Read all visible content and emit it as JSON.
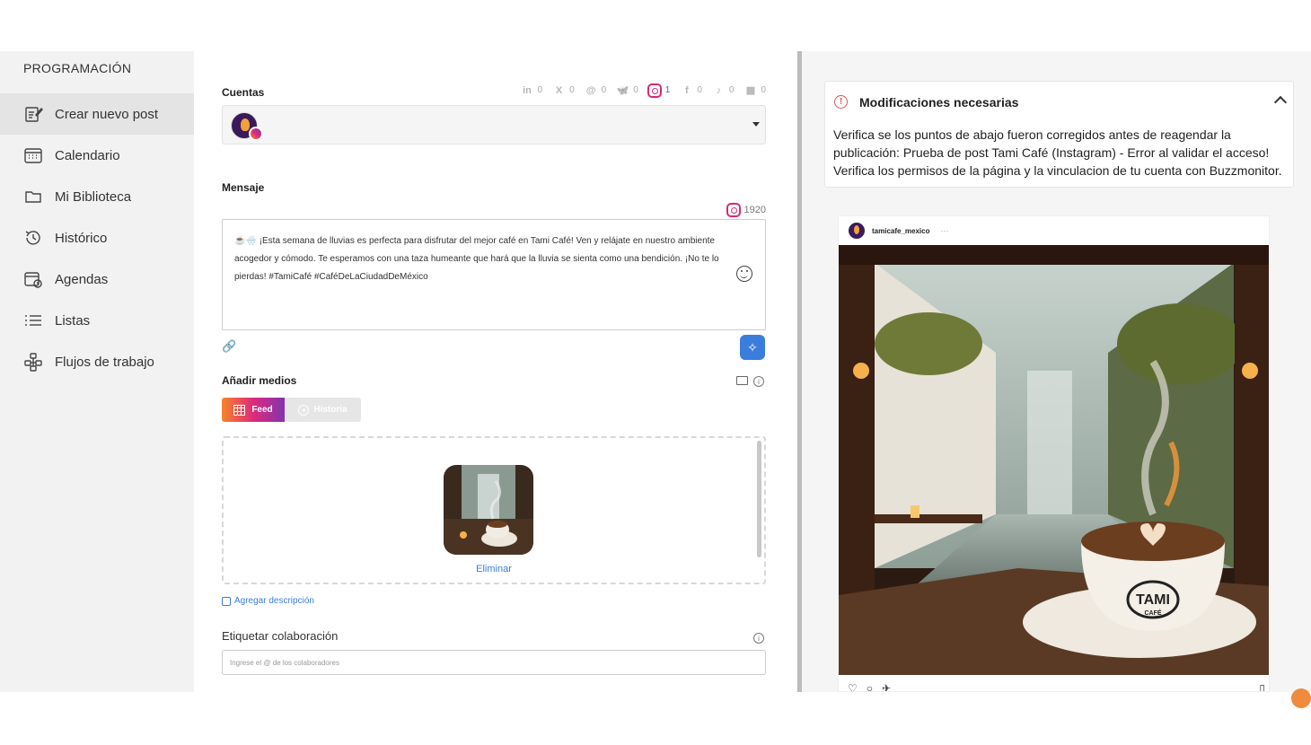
{
  "sidebar": {
    "heading": "PROGRAMACIÓN",
    "items": [
      {
        "label": "Crear nuevo post",
        "icon": "edit-post-icon",
        "active": true
      },
      {
        "label": "Calendario",
        "icon": "calendar-icon"
      },
      {
        "label": "Mi Biblioteca",
        "icon": "folder-icon"
      },
      {
        "label": "Histórico",
        "icon": "history-icon"
      },
      {
        "label": "Agendas",
        "icon": "schedule-icon"
      },
      {
        "label": "Listas",
        "icon": "list-icon"
      },
      {
        "label": "Flujos de trabajo",
        "icon": "workflow-icon"
      }
    ]
  },
  "composer": {
    "accounts_label": "Cuentas",
    "networks": [
      {
        "name": "linkedin-icon",
        "glyph": "in",
        "count": "0"
      },
      {
        "name": "x-icon",
        "glyph": "X",
        "count": "0"
      },
      {
        "name": "threads-icon",
        "glyph": "@",
        "count": "0"
      },
      {
        "name": "bluesky-icon",
        "glyph": "🦋",
        "count": "0"
      },
      {
        "name": "instagram-icon",
        "glyph": "◎",
        "count": "1"
      },
      {
        "name": "facebook-icon",
        "glyph": "f",
        "count": "0"
      },
      {
        "name": "tiktok-icon",
        "glyph": "♪",
        "count": "0"
      },
      {
        "name": "google-business-icon",
        "glyph": "▦",
        "count": "0"
      }
    ],
    "message_label": "Mensaje",
    "char_limit": "1920",
    "message_text": "☕🌧️ ¡Esta semana de lluvias es perfecta para disfrutar del mejor café en Tami Café! Ven y relájate en nuestro ambiente acogedor y cómodo. Te esperamos con una taza humeante que hará que la lluvia se sienta como una bendición. ¡No te lo pierdas! #TamiCafé #CaféDeLaCiudadDeMéxico",
    "media_label": "Añadir medios",
    "tab_feed": "Feed",
    "tab_story": "Historia",
    "delete_label": "Eliminar",
    "add_description": "Agregar descripción",
    "collab_label": "Etiquetar colaboración",
    "collab_placeholder": "Ingrese el @ de los colaboradores"
  },
  "alert": {
    "title": "Modificaciones necesarias",
    "body": "Verifica se los puntos de abajo fueron corregidos antes de reagendar la publicación: Prueba de post Tami Café (Instagram) - Error al validar el acceso! Verifica los permisos de la página y la vinculacion de tu cuenta con Buzzmonitor."
  },
  "preview": {
    "username": "tamicafe_mexico",
    "more": "···",
    "cup_brand": "TAMI",
    "cup_sub": "CAFÉ"
  },
  "colors": {
    "accent_blue": "#3b7ddd",
    "alert_red": "#e05555",
    "instagram_gradient": [
      "#f58529",
      "#dd2a7b",
      "#8134af"
    ]
  }
}
